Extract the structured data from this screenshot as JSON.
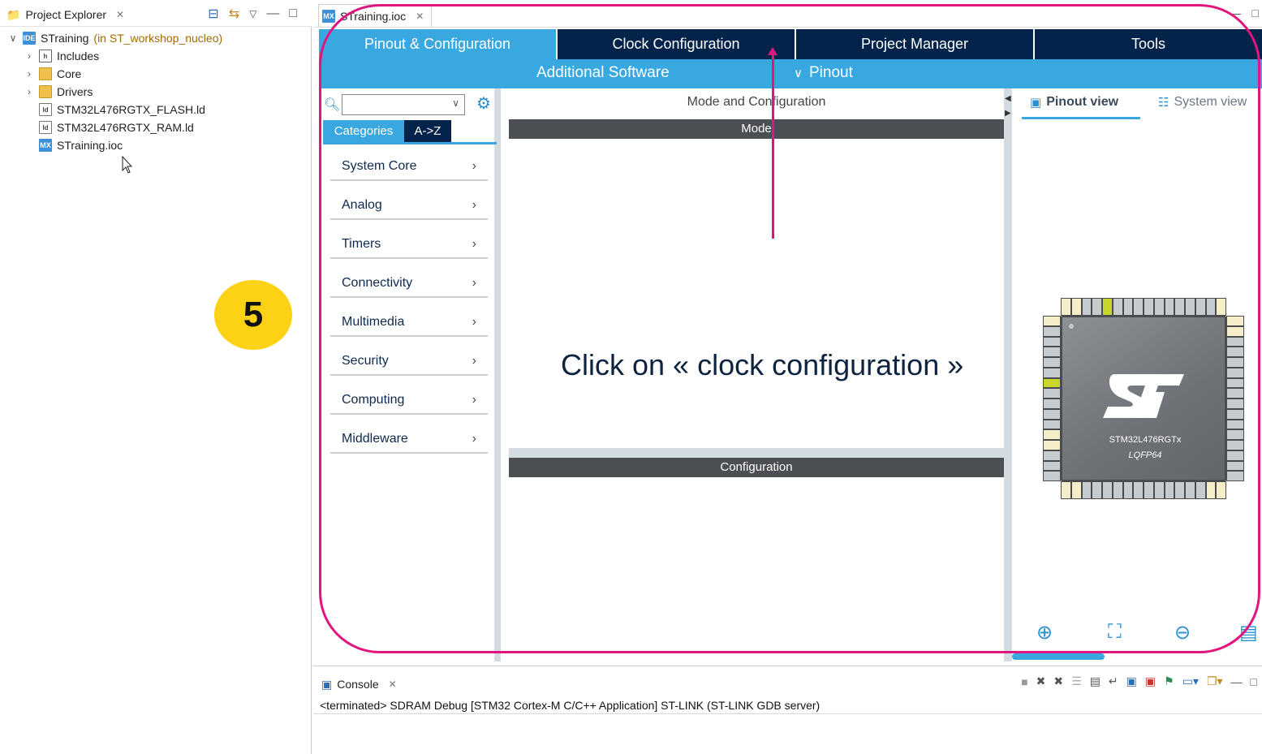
{
  "project_explorer": {
    "tab_title": "Project Explorer",
    "tree": [
      {
        "label": "STraining",
        "suffix": "(in ST_workshop_nucleo)",
        "icon": "ide-project-icon"
      },
      {
        "label": "Includes",
        "icon": "includes-icon"
      },
      {
        "label": "Core",
        "icon": "folder-icon"
      },
      {
        "label": "Drivers",
        "icon": "folder-icon"
      },
      {
        "label": "STM32L476RGTX_FLASH.ld",
        "icon": "linker-file-icon"
      },
      {
        "label": "STM32L476RGTX_RAM.ld",
        "icon": "linker-file-icon"
      },
      {
        "label": "STraining.ioc",
        "icon": "mx-file-icon"
      }
    ]
  },
  "editor": {
    "tab_title": "STraining.ioc",
    "main_tabs": [
      "Pinout & Configuration",
      "Clock Configuration",
      "Project Manager",
      "Tools"
    ],
    "sub_tabs": {
      "additional": "Additional Software",
      "pinout": "Pinout"
    },
    "categories": {
      "toggle": [
        "Categories",
        "A->Z"
      ],
      "items": [
        "System Core",
        "Analog",
        "Timers",
        "Connectivity",
        "Multimedia",
        "Security",
        "Computing",
        "Middleware"
      ]
    },
    "middle": {
      "title": "Mode and Configuration",
      "mode_header": "Mode",
      "config_header": "Configuration"
    },
    "right": {
      "pinout_view": "Pinout view",
      "system_view": "System view",
      "chip_name": "STM32L476RGTx",
      "package": "LQFP64"
    }
  },
  "annotation": {
    "step_number": "5",
    "instruction": "Click on « clock configuration »",
    "accent_color": "#e0157e",
    "badge_color": "#fcd116"
  },
  "console": {
    "tab_title": "Console",
    "output": "<terminated> SDRAM Debug [STM32 Cortex-M C/C++ Application] ST-LINK (ST-LINK GDB server)"
  },
  "colors": {
    "tab_active": "#39a7e0",
    "tab_dark": "#03234b"
  }
}
